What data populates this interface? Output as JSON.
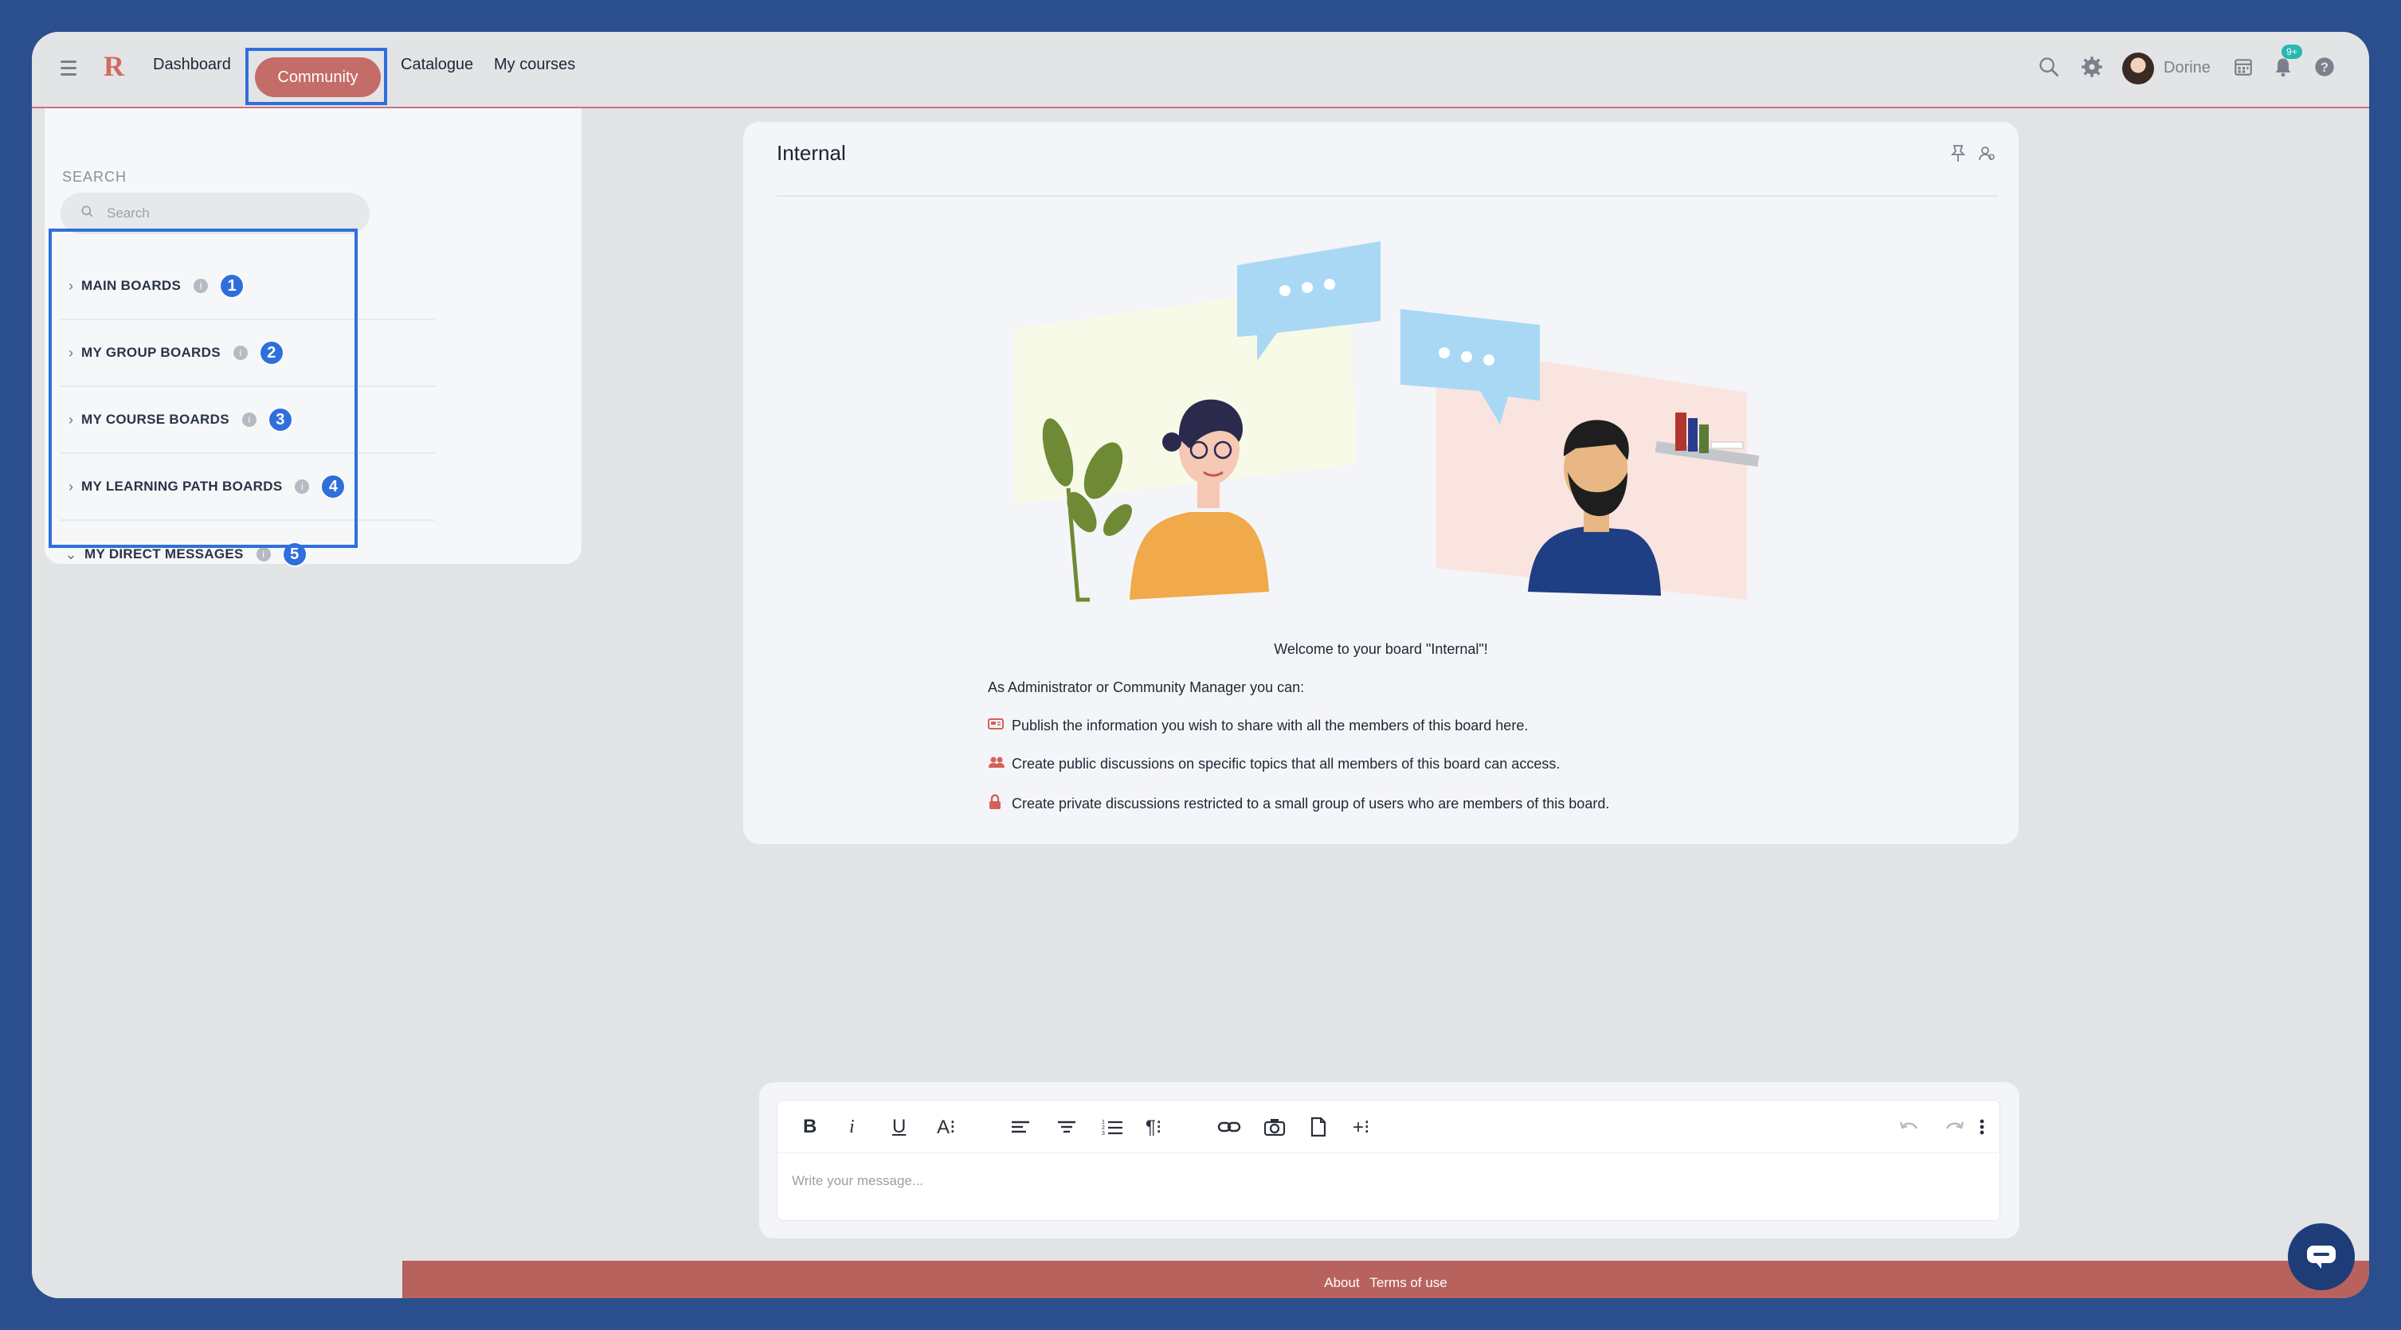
{
  "topbar": {
    "logo": "R",
    "nav": [
      "Dashboard",
      "Community",
      "Catalogue",
      "My courses"
    ],
    "active_nav": "Community",
    "user_name": "Dorine",
    "notification_badge": "9+",
    "icons": [
      "search-icon",
      "gear-icon",
      "avatar",
      "calendar-icon",
      "bell-icon",
      "help-icon"
    ]
  },
  "sidebar": {
    "search_label": "SEARCH",
    "search_placeholder": "Search",
    "boards": [
      {
        "label": "MAIN BOARDS",
        "marker": "1",
        "expanded": false
      },
      {
        "label": "MY GROUP BOARDS",
        "marker": "2",
        "expanded": false
      },
      {
        "label": "MY COURSE BOARDS",
        "marker": "3",
        "expanded": false
      },
      {
        "label": "MY LEARNING PATH BOARDS",
        "marker": "4",
        "expanded": false
      },
      {
        "label": "MY DIRECT MESSAGES",
        "marker": "5",
        "expanded": true
      }
    ]
  },
  "board": {
    "title": "Internal",
    "welcome": "Welcome to your board \"Internal\"!",
    "intro": "As Administrator or Community Manager you can:",
    "bullets": [
      "Publish the information you wish to share with all the members of this board here.",
      "Create public discussions on specific topics that all members of this board can access.",
      "Create private discussions restricted to a small group of users who are members of this board."
    ]
  },
  "editor": {
    "placeholder": "Write your message...",
    "tools": [
      "B",
      "i",
      "U",
      "A⁝",
      "align-left",
      "align-center",
      "list-ordered",
      "¶⁝",
      "link",
      "camera",
      "file",
      "+⁝",
      "undo",
      "redo",
      "more"
    ]
  },
  "footer": {
    "links": [
      "About",
      "Terms of use"
    ]
  },
  "colors": {
    "accent": "#c46c68",
    "highlight": "#2f6fdc",
    "background": "#2b4f8e",
    "footer": "#b8625e"
  }
}
